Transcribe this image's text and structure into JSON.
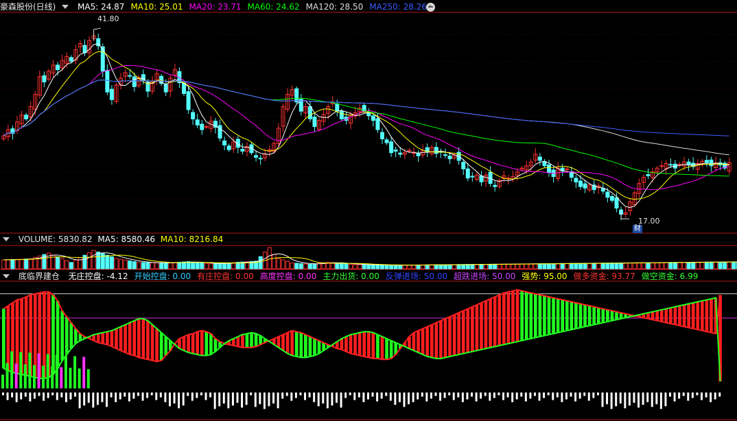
{
  "header": {
    "title": "豪森股份(日线)",
    "ma": [
      {
        "label": "MA5: 24.87",
        "color": "#ffffff"
      },
      {
        "label": "MA10: 25.01",
        "color": "#ffff00"
      },
      {
        "label": "MA20: 23.71",
        "color": "#ff00ff"
      },
      {
        "label": "MA60: 24.62",
        "color": "#00ff00"
      },
      {
        "label": "MA120: 28.50",
        "color": "#dddddd"
      },
      {
        "label": "MA250: 28.26",
        "color": "#3c5cff"
      }
    ]
  },
  "volume_header": {
    "title": "VOLUME: 5830.82",
    "ma5": "MA5: 8580.46",
    "ma10": "MA10: 8216.84",
    "colors": {
      "title": "#e6e6e6",
      "ma5": "#ffffff",
      "ma10": "#ffff00"
    }
  },
  "indicator_header": {
    "title": "底临界建仓",
    "items": [
      {
        "label": "无庄控盘: -4.12",
        "color": "#ffffff"
      },
      {
        "label": "开始控盘: 0.00",
        "color": "#33ccff"
      },
      {
        "label": "有庄控盘: 0.00",
        "color": "#ff3333"
      },
      {
        "label": "高度控盘: 0.00",
        "color": "#ff33ff"
      },
      {
        "label": "主力出货: 0.00",
        "color": "#33ff33"
      },
      {
        "label": "反弹进场: 50.00",
        "color": "#3344ff"
      },
      {
        "label": "超跌进场: 50.00",
        "color": "#cc44ff"
      },
      {
        "label": "强势: 95.00",
        "color": "#ffff00"
      },
      {
        "label": "做多资金: 93.77",
        "color": "#ff3333"
      },
      {
        "label": "做空资金: 6.99",
        "color": "#33ff33"
      }
    ]
  },
  "annotations": {
    "high": "41.80",
    "low": "17.00",
    "badge": "财"
  },
  "colors": {
    "up": "#ff3232",
    "down": "#54ffff",
    "panel_border": "#b01818"
  },
  "chart_data": [
    {
      "type": "candlestick",
      "name_in_header": "豪森股份(日线)",
      "ylim": [
        15.5,
        43.5
      ],
      "annotated_high": 41.8,
      "annotated_low": 17.0,
      "close": [
        27.8,
        28.6,
        28.1,
        29.6,
        30.5,
        30.0,
        31.6,
        33.2,
        35.5,
        34.8,
        36.2,
        37.0,
        36.4,
        37.6,
        38.1,
        37.5,
        39.0,
        39.8,
        38.6,
        40.2,
        40.8,
        39.5,
        36.2,
        33.5,
        32.5,
        34.4,
        35.3,
        36.0,
        35.6,
        34.2,
        35.4,
        35.0,
        33.6,
        34.8,
        35.9,
        34.6,
        33.5,
        35.3,
        36.4,
        34.7,
        33.3,
        31.2,
        30.0,
        29.2,
        28.6,
        29.0,
        29.7,
        28.9,
        27.5,
        26.6,
        26.0,
        27.0,
        26.3,
        25.8,
        26.4,
        25.6,
        25.0,
        24.8,
        25.4,
        26.0,
        26.8,
        28.8,
        31.6,
        33.2,
        33.8,
        32.2,
        31.0,
        31.6,
        30.0,
        29.0,
        29.8,
        30.6,
        31.6,
        32.2,
        31.0,
        30.0,
        29.8,
        30.5,
        30.8,
        31.4,
        31.0,
        30.4,
        29.8,
        28.6,
        27.4,
        26.9,
        25.6,
        25.8,
        25.4,
        25.6,
        25.9,
        25.6,
        25.2,
        25.9,
        25.7,
        26.3,
        25.5,
        25.7,
        25.3,
        24.8,
        25.3,
        24.6,
        23.5,
        22.3,
        22.5,
        22.7,
        21.8,
        22.7,
        21.6,
        21.2,
        22.0,
        22.6,
        22.3,
        22.5,
        23.1,
        23.6,
        23.9,
        24.4,
        25.4,
        24.6,
        23.9,
        23.0,
        22.5,
        23.6,
        23.2,
        23.5,
        22.4,
        21.8,
        21.2,
        21.0,
        21.4,
        20.8,
        21.3,
        20.6,
        19.8,
        19.4,
        18.4,
        17.6,
        17.8,
        19.2,
        20.4,
        21.6,
        22.4,
        22.6,
        23.1,
        23.6,
        23.9,
        24.2,
        24.0,
        23.6,
        24.1,
        24.4,
        24.0,
        23.8,
        24.2,
        24.5,
        24.3,
        23.9,
        24.3,
        24.0,
        23.6,
        24.3
      ]
    },
    {
      "type": "bar",
      "name_in_header": "VOLUME",
      "values": [
        10000,
        10200,
        10400,
        10600,
        10800,
        11000,
        11200,
        12800,
        14400,
        16000,
        17600,
        15500,
        13400,
        11300,
        9200,
        7100,
        9800,
        12500,
        15200,
        17900,
        20600,
        18800,
        17000,
        15200,
        13400,
        11600,
        10700,
        9800,
        8900,
        8000,
        7100,
        7000,
        6900,
        6800,
        6700,
        6600,
        6500,
        6800,
        7100,
        7400,
        7700,
        8000,
        7500,
        7000,
        6500,
        6000,
        5500,
        5800,
        6100,
        6400,
        6700,
        7000,
        7300,
        7600,
        7900,
        8200,
        8500,
        13600,
        18700,
        23800,
        16100,
        11700,
        10000,
        8300,
        6600,
        6200,
        5800,
        5400,
        5000,
        5600,
        6200,
        6800,
        7400,
        6900,
        6400,
        5900,
        5400,
        4900,
        4800,
        4700,
        4600,
        4500,
        4400,
        4300,
        4200,
        4100,
        4000,
        4050,
        4100,
        4150,
        4200,
        4250,
        4300,
        4350,
        4400,
        4450,
        4500,
        4550,
        4600,
        4650,
        4700,
        4750,
        4800,
        4850,
        4900,
        4950,
        5000,
        5050,
        5100,
        5150,
        5200,
        5250,
        5300,
        5350,
        5400,
        5450,
        5500,
        5550,
        5600,
        5650,
        5700,
        5750,
        5800,
        5850,
        5900,
        5950,
        6000,
        6050,
        6100,
        6150,
        6200,
        6250,
        6300,
        6350,
        6400,
        6450,
        6500,
        6550,
        6600,
        6650,
        6700,
        6750,
        6800,
        6850,
        6900,
        6950,
        7000,
        7050,
        7100,
        7150,
        7200,
        7250,
        7300,
        7350,
        7400,
        7450,
        7500,
        7550,
        7600,
        7650,
        7700,
        7750,
        7800,
        7850,
        5830.82
      ]
    },
    {
      "type": "line",
      "name_in_header": "底临界建仓",
      "ylim": [
        -30,
        105
      ],
      "levels": [
        95,
        50
      ],
      "series": [
        {
          "name": "做多资金",
          "color": "#ff2020",
          "values": [
            80,
            83,
            86,
            89,
            90,
            92,
            94,
            95,
            96,
            97,
            97,
            94,
            88,
            78,
            72,
            66,
            60,
            55,
            52,
            50,
            48,
            46,
            45,
            44,
            42,
            40,
            38,
            36,
            34,
            33,
            31,
            30,
            29,
            28,
            27,
            28,
            33,
            38,
            45,
            50,
            52,
            54,
            55,
            57,
            58,
            57,
            55,
            50,
            47,
            45,
            44,
            43,
            42,
            41,
            41,
            41,
            42,
            44,
            46,
            48,
            50,
            52,
            54,
            56,
            58,
            57,
            56,
            54,
            52,
            50,
            48,
            46,
            44,
            42,
            40,
            39,
            37,
            35,
            34,
            33,
            32,
            31,
            30,
            30,
            29,
            29,
            30,
            34,
            40,
            46,
            52,
            56,
            58,
            60,
            62,
            64,
            66,
            68,
            70,
            72,
            74,
            76,
            78,
            80,
            82,
            84,
            86,
            88,
            90,
            92,
            94,
            96,
            97,
            98,
            99,
            98,
            97,
            96,
            95,
            94,
            93,
            92,
            91,
            90,
            89,
            88,
            87,
            86,
            85,
            84,
            83,
            82,
            81,
            80,
            79,
            78,
            77,
            76,
            75,
            74,
            73,
            72,
            71,
            70,
            69,
            68,
            67,
            66,
            65,
            64,
            63,
            62,
            61,
            60,
            59,
            58,
            57,
            56,
            55,
            93.77
          ]
        },
        {
          "name": "做空资金",
          "color": "#20ff20",
          "values": [
            20,
            18,
            16,
            15,
            14,
            13,
            12,
            11,
            10,
            10,
            11,
            14,
            20,
            28,
            34,
            40,
            45,
            48,
            50,
            52,
            54,
            55,
            56,
            57,
            58,
            60,
            62,
            64,
            66,
            68,
            70,
            70,
            68,
            64,
            60,
            56,
            52,
            48,
            44,
            40,
            38,
            36,
            35,
            34,
            33,
            33,
            34,
            37,
            41,
            45,
            48,
            50,
            52,
            54,
            55,
            56,
            55,
            53,
            50,
            47,
            44,
            41,
            38,
            35,
            33,
            32,
            31,
            31,
            32,
            33,
            35,
            38,
            41,
            44,
            47,
            50,
            52,
            54,
            55,
            56,
            57,
            57,
            56,
            54,
            52,
            50,
            48,
            46,
            44,
            42,
            40,
            38,
            36,
            34,
            32,
            31,
            30,
            30,
            31,
            32,
            33,
            34,
            35,
            36,
            37,
            38,
            39,
            40,
            41,
            42,
            43,
            44,
            45,
            46,
            47,
            48,
            49,
            50,
            51,
            52,
            53,
            54,
            55,
            56,
            57,
            58,
            59,
            60,
            61,
            62,
            63,
            64,
            65,
            66,
            67,
            68,
            69,
            70,
            71,
            72,
            73,
            74,
            75,
            76,
            77,
            78,
            79,
            80,
            81,
            82,
            83,
            84,
            85,
            86,
            87,
            88,
            89,
            90,
            91,
            6.99
          ]
        },
        {
          "name": "强势",
          "color": "#20ff20",
          "values": [
            95,
            95,
            95,
            95,
            95,
            95,
            95,
            95,
            95,
            95,
            95,
            95,
            95,
            95,
            95,
            95,
            95,
            95,
            95,
            95,
            95,
            95,
            95,
            95,
            95,
            95,
            95,
            95,
            95,
            95,
            95,
            95,
            95,
            95,
            95,
            95,
            95,
            95,
            95,
            95,
            95,
            95,
            95,
            95,
            95,
            95,
            95,
            95,
            95,
            95,
            95,
            95,
            95,
            95,
            95,
            95,
            95,
            95,
            95,
            95,
            95,
            95,
            95,
            95,
            95,
            95,
            95,
            95,
            95,
            95,
            95,
            95,
            95,
            95,
            95,
            95,
            95,
            95,
            95,
            95,
            95,
            95,
            95,
            95,
            95,
            95,
            95,
            95,
            95,
            95,
            95,
            95,
            95,
            95,
            95,
            95,
            95,
            95,
            95,
            95,
            95,
            95,
            95,
            95,
            95,
            95,
            95,
            95,
            95,
            95,
            95,
            95,
            95,
            95,
            95,
            95,
            95,
            95,
            95,
            95,
            95,
            95,
            95,
            95,
            95,
            95,
            95,
            95,
            95,
            95,
            95,
            95,
            95,
            95,
            95,
            95,
            95,
            95,
            95,
            95,
            95,
            95,
            95,
            95,
            95,
            95,
            95,
            95,
            95,
            95,
            95,
            95,
            95,
            95,
            95,
            95,
            95,
            95,
            95,
            95,
            95,
            95,
            95,
            95,
            95,
            95
          ]
        }
      ]
    }
  ]
}
